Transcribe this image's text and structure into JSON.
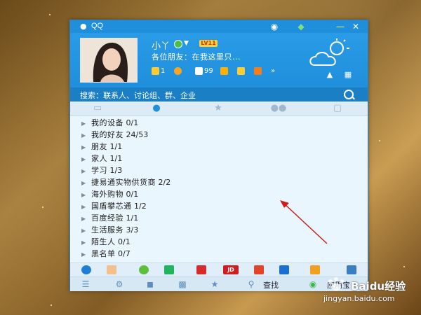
{
  "window": {
    "title": "QQ"
  },
  "profile": {
    "nickname": "小丫",
    "level_badge": "LV11",
    "signature": "各位朋友：在我这里只...",
    "stats": [
      "1",
      "99"
    ]
  },
  "search": {
    "placeholder": "搜索：联系人、讨论组、群、企业"
  },
  "tabs": [
    {
      "icon": "message-icon"
    },
    {
      "icon": "contacts-icon",
      "active": true
    },
    {
      "icon": "star-icon"
    },
    {
      "icon": "group-icon"
    },
    {
      "icon": "square-icon"
    }
  ],
  "groups": [
    {
      "label": "我的设备",
      "count": "0/1"
    },
    {
      "label": "我的好友",
      "count": "24/53"
    },
    {
      "label": "朋友",
      "count": "1/1"
    },
    {
      "label": "家人",
      "count": "1/1"
    },
    {
      "label": "学习",
      "count": "1/3"
    },
    {
      "label": "捷易通实物供货商",
      "count": "2/2"
    },
    {
      "label": "海外购物",
      "count": "0/1"
    },
    {
      "label": "国盾攀芯通",
      "count": "1/2"
    },
    {
      "label": "百度经验",
      "count": "1/1"
    },
    {
      "label": "生活服务",
      "count": "3/3"
    },
    {
      "label": "陌生人",
      "count": "0/1"
    },
    {
      "label": "黑名单",
      "count": "0/7"
    }
  ],
  "app_bar": {
    "jd_label": "JD"
  },
  "bottom_bar": {
    "find_label": "查找",
    "apps_label": "应用宝"
  },
  "watermark": {
    "brand": "Baidu",
    "jingyan": "经验",
    "url": "jingyan.baidu.com"
  },
  "colors": {
    "titlebar": "#1f8fdc",
    "panel_bg": "#eaf6fd",
    "annotation_arrow": "#d11a1a"
  }
}
